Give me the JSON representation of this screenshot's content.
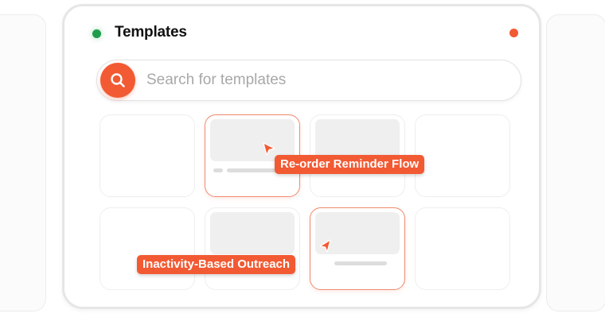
{
  "window": {
    "title": "Templates",
    "status_dot_color": "#1e9e4c",
    "close_dot_color": "#f25a33"
  },
  "search": {
    "placeholder": "Search for templates",
    "value": "",
    "icon": "search-icon"
  },
  "colors": {
    "accent": "#f25a33",
    "card_border": "#eeeeee",
    "placeholder_fill": "#efefef"
  },
  "templates": {
    "callouts": [
      {
        "label": "Re-order Reminder Flow",
        "icon": "cursor-arrow-icon"
      },
      {
        "label": "Inactivity-Based Outreach",
        "icon": "cursor-arrow-icon"
      }
    ]
  }
}
